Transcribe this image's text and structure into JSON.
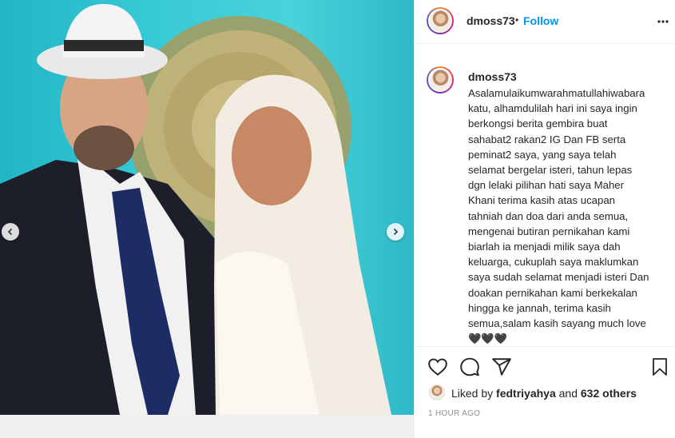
{
  "post": {
    "username": "dmoss73",
    "separator": "•",
    "follow_label": "Follow",
    "more_icon": "more-horizontal-icon",
    "caption": "Asalamulaikumwarahmatullahiwabara\nkatu, alhamdulilah hari ini saya ingin\nberkongsi berita gembira buat\nsahabat2 rakan2 IG Dan FB serta\npeminat2 saya, yang saya telah\nselamat bergelar isteri, tahun lepas\ndgn lelaki pilihan hati saya Maher\nKhani terima kasih atas ucapan\ntahniah dan doa dari anda semua,\nmengenai butiran pernikahan kami\nbiarlah ia menjadi milik saya dah\nkeluarga, cukuplah saya maklumkan\nsaya sudah selamat menjadi isteri Dan\ndoakan pernikahan kami berkekalan\nhingga ke jannah, terima kasih\nsemua,salam kasih sayang much love\n🖤🖤🖤",
    "likes_prefix": "Liked by",
    "liked_by_user": "fedtriyahya",
    "likes_and": "and",
    "likes_others": "632 others",
    "timestamp": "1 HOUR AGO"
  },
  "icons": {
    "like": "heart-icon",
    "comment": "comment-icon",
    "share": "paper-plane-icon",
    "save": "bookmark-icon",
    "prev": "chevron-left-icon",
    "next": "chevron-right-icon"
  }
}
